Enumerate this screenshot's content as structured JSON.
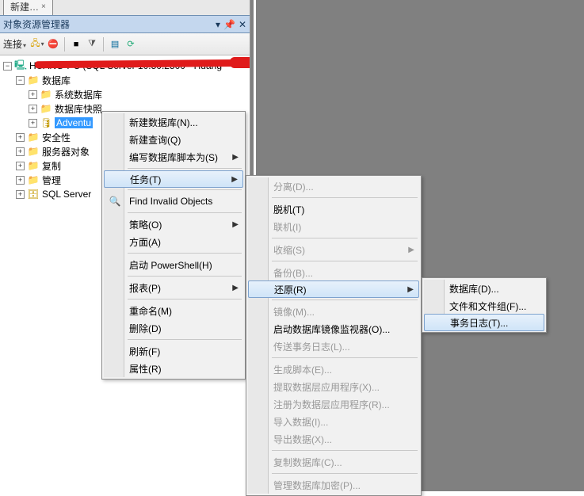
{
  "tab": {
    "title": "新建…",
    "close": "×"
  },
  "panel": {
    "title": "对象资源管理器",
    "pin": "📌",
    "close": "✕",
    "dd": "▾"
  },
  "toolbar": {
    "connect": "连接"
  },
  "tree": {
    "server": "HUANG-PC (SQL Server 10.50.2500 - Huang",
    "databases": "数据库",
    "sysdb": "系统数据库",
    "snap": "数据库快照",
    "adv": "Adventu",
    "security": "安全性",
    "serverobj": "服务器对象",
    "replication": "复制",
    "mgmt": "管理",
    "agent": "SQL Server"
  },
  "menu1": {
    "newdb": "新建数据库(N)...",
    "newquery": "新建查询(Q)",
    "script": "编写数据库脚本为(S)",
    "tasks": "任务(T)",
    "findinvalid": "Find Invalid Objects",
    "policy": "策略(O)",
    "facet": "方面(A)",
    "powershell": "启动 PowerShell(H)",
    "reports": "报表(P)",
    "rename": "重命名(M)",
    "delete": "删除(D)",
    "refresh": "刷新(F)",
    "props": "属性(R)"
  },
  "menu2": {
    "detach": "分离(D)...",
    "offline": "脱机(T)",
    "online": "联机(I)",
    "shrink": "收缩(S)",
    "backup": "备份(B)...",
    "restore": "还原(R)",
    "mirror": "镜像(M)...",
    "launchmon": "启动数据库镜像监视器(O)...",
    "shiplog": "传送事务日志(L)...",
    "genscript": "生成脚本(E)...",
    "extract": "提取数据层应用程序(X)...",
    "register": "注册为数据层应用程序(R)...",
    "import": "导入数据(I)...",
    "export": "导出数据(X)...",
    "copy": "复制数据库(C)...",
    "encrypt": "管理数据库加密(P)..."
  },
  "menu3": {
    "database": "数据库(D)...",
    "files": "文件和文件组(F)...",
    "tlog": "事务日志(T)..."
  }
}
